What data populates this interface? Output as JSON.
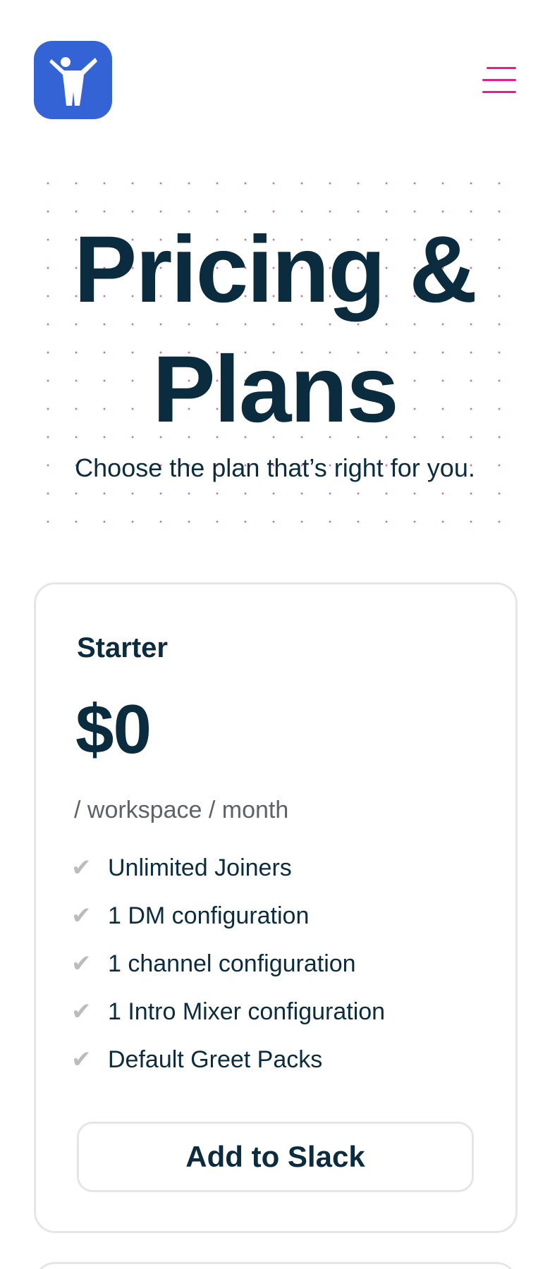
{
  "header": {
    "logo_icon": "person-arms-raised-icon",
    "menu_icon": "hamburger-menu-icon",
    "brand_color": "#3463d5",
    "accent_color": "#e21f8b"
  },
  "hero": {
    "title": "Pricing & Plans",
    "subtitle": "Choose the plan that’s right for you."
  },
  "plans": [
    {
      "name": "Starter",
      "price": "$0",
      "period": "/ workspace / month",
      "features": [
        "Unlimited Joiners",
        "1 DM configuration",
        "1 channel configuration",
        "1 Intro Mixer configuration",
        "Default Greet Packs"
      ],
      "cta_label": "Add to Slack",
      "check_icon": "checkmark-icon"
    }
  ]
}
